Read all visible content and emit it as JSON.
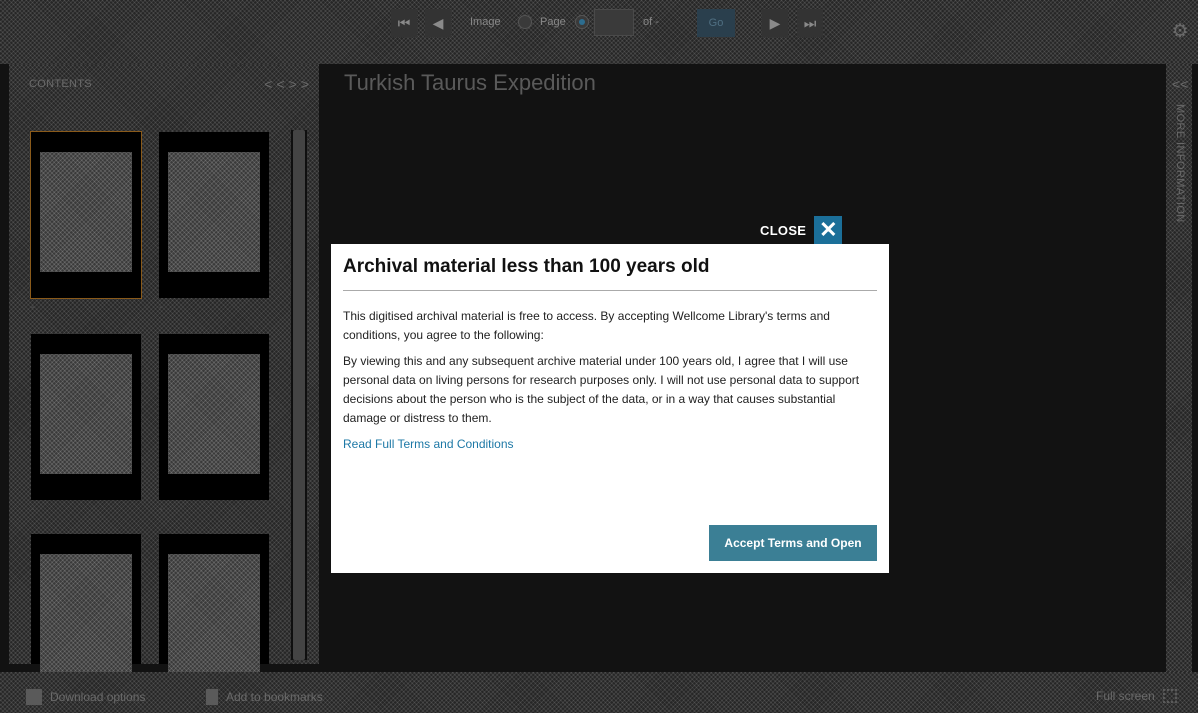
{
  "toolbar": {
    "first_label": "⏮",
    "prev_label": "◀",
    "image_label": "Image",
    "page_label": "Page",
    "page_value": "",
    "of_label": "of -",
    "go_label": "Go",
    "next_label": "▶",
    "last_label": "⏭",
    "selected_mode": "Page"
  },
  "contents": {
    "title": "CONTENTS",
    "collapse_label": "<<",
    "expand_label": ">>",
    "thumbnails": [
      {
        "label": "-",
        "selected": true
      },
      {
        "label": "-",
        "selected": false
      },
      {
        "label": "-",
        "selected": false
      },
      {
        "label": "-",
        "selected": false
      },
      {
        "label": "",
        "selected": false
      },
      {
        "label": "",
        "selected": false
      }
    ]
  },
  "main": {
    "title": "Turkish Taurus Expedition"
  },
  "more_info": {
    "arrow_label": "<<",
    "label": "MORE INFORMATION"
  },
  "footer": {
    "download_label": "Download options",
    "bookmark_label": "Add to bookmarks",
    "fullscreen_label": "Full screen"
  },
  "modal": {
    "close_label": "CLOSE",
    "close_x": "✕",
    "heading": "Archival material less than 100 years old",
    "para1": "This digitised archival material is free to access. By accepting Wellcome Library's terms and conditions, you agree to the following:",
    "para2": "By viewing this and any subsequent archive material under 100 years old, I agree that I will use personal data on living persons for research purposes only. I will not use personal data to support decisions about the person who is the subject of the data, or in a way that causes substantial damage or distress to them.",
    "terms_link": "Read Full Terms and Conditions",
    "accept_label": "Accept Terms and Open"
  },
  "colors": {
    "accent": "#1b6f99",
    "accept_button": "#3b7f95",
    "link": "#1d78a6"
  }
}
